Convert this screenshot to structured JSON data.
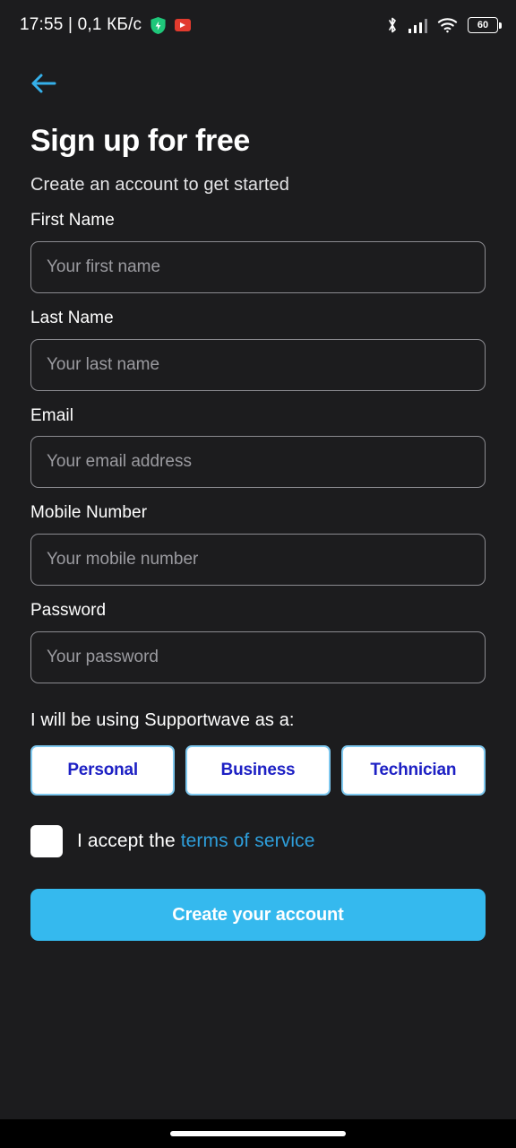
{
  "status_bar": {
    "clock_and_network": "17:55 | 0,1 КБ/с",
    "shield_icon": "shield-icon",
    "youtube_icon": "youtube-badge-icon",
    "bluetooth_icon": "bluetooth-icon",
    "signal_icon": "cellular-signal-icon",
    "wifi_icon": "wifi-icon",
    "battery_level": "60"
  },
  "nav": {
    "back_icon": "back-arrow-icon"
  },
  "header": {
    "title": "Sign up for free",
    "subtitle": "Create an account to get started"
  },
  "form": {
    "fields": [
      {
        "label": "First Name",
        "placeholder": "Your first name",
        "value": ""
      },
      {
        "label": "Last Name",
        "placeholder": "Your last name",
        "value": ""
      },
      {
        "label": "Email",
        "placeholder": "Your email address",
        "value": ""
      },
      {
        "label": "Mobile Number",
        "placeholder": "Your mobile number",
        "value": ""
      },
      {
        "label": "Password",
        "placeholder": "Your password",
        "value": ""
      }
    ],
    "role_question": "I will be using Supportwave as a:",
    "roles": [
      {
        "label": "Personal"
      },
      {
        "label": "Business"
      },
      {
        "label": "Technician"
      }
    ],
    "terms": {
      "checked": false,
      "prefix": "I accept the ",
      "link_label": "terms of service"
    },
    "submit_label": "Create your account"
  },
  "colors": {
    "page_background": "#1c1c1e",
    "accent_blue": "#35b9ee",
    "link_blue": "#2e9fdc",
    "role_text_blue": "#1d20c4",
    "role_border_blue": "#7ec8ef",
    "field_border": "#8b8b90",
    "placeholder_text": "#9b9ba0"
  }
}
